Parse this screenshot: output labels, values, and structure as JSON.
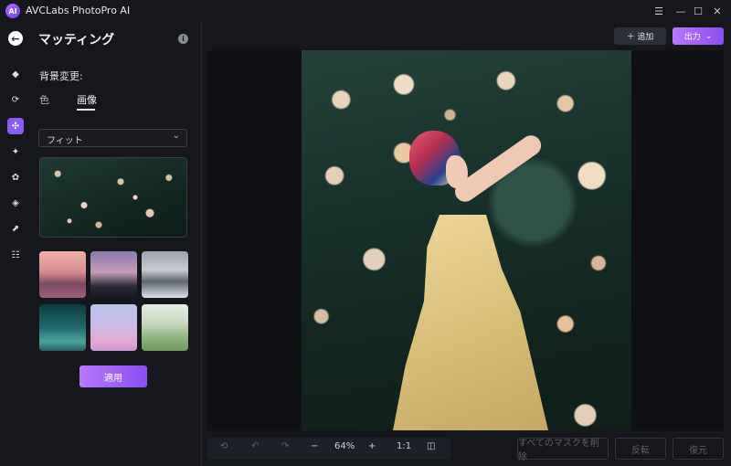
{
  "window": {
    "title": "AVCLabs PhotoPro AI",
    "logo_text": "AI",
    "controls": {
      "menu": "☰",
      "minimize": "—",
      "maximize": "☐",
      "close": "✕"
    }
  },
  "panel": {
    "title": "マッティング",
    "section_label": "背景変更:",
    "tabs": [
      {
        "label": "色"
      },
      {
        "label": "画像"
      }
    ],
    "active_tab": "画像",
    "fit_select": {
      "value": "フィット"
    },
    "apply_label": "適用"
  },
  "toolbar": {
    "add_label": "＋ 追加",
    "export_label": "出力"
  },
  "zoom": {
    "minus": "−",
    "value": "64%",
    "plus": "+",
    "ratio": "1:1"
  },
  "actions": {
    "clear_masks": "すべてのマスクを削除",
    "invert": "反転",
    "restore": "復元"
  },
  "rail_icons": [
    "eraser-icon",
    "face-swap-icon",
    "matting-icon",
    "sparkle-icon",
    "flower-icon",
    "paint-bucket-icon",
    "resize-icon",
    "sliders-icon"
  ],
  "colors": {
    "accent": "#8a5cf5",
    "background": "#15171c"
  }
}
